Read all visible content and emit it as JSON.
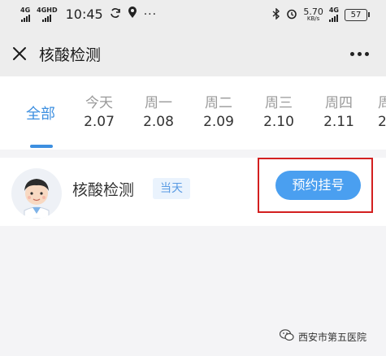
{
  "status_bar": {
    "signal1": "4G",
    "signal2": "4GHD",
    "time": "10:45",
    "more": "···",
    "net_speed": "5.70",
    "net_unit": "KB/s",
    "signal3": "4G",
    "battery": "57"
  },
  "header": {
    "title": "核酸检测"
  },
  "date_tabs": [
    {
      "weekday": "全部",
      "date": ""
    },
    {
      "weekday": "今天",
      "date": "2.07"
    },
    {
      "weekday": "周一",
      "date": "2.08"
    },
    {
      "weekday": "周二",
      "date": "2.09"
    },
    {
      "weekday": "周三",
      "date": "2.10"
    },
    {
      "weekday": "周四",
      "date": "2.11"
    },
    {
      "weekday": "周",
      "date": "2"
    }
  ],
  "service": {
    "name": "核酸检测",
    "badge": "当天",
    "button_label": "预约挂号"
  },
  "watermark": {
    "text": "西安市第五医院"
  },
  "colors": {
    "accent": "#3d8fe0",
    "button": "#4a9ff0",
    "highlight_border": "#d32020",
    "badge_bg": "#eaf3fd"
  }
}
